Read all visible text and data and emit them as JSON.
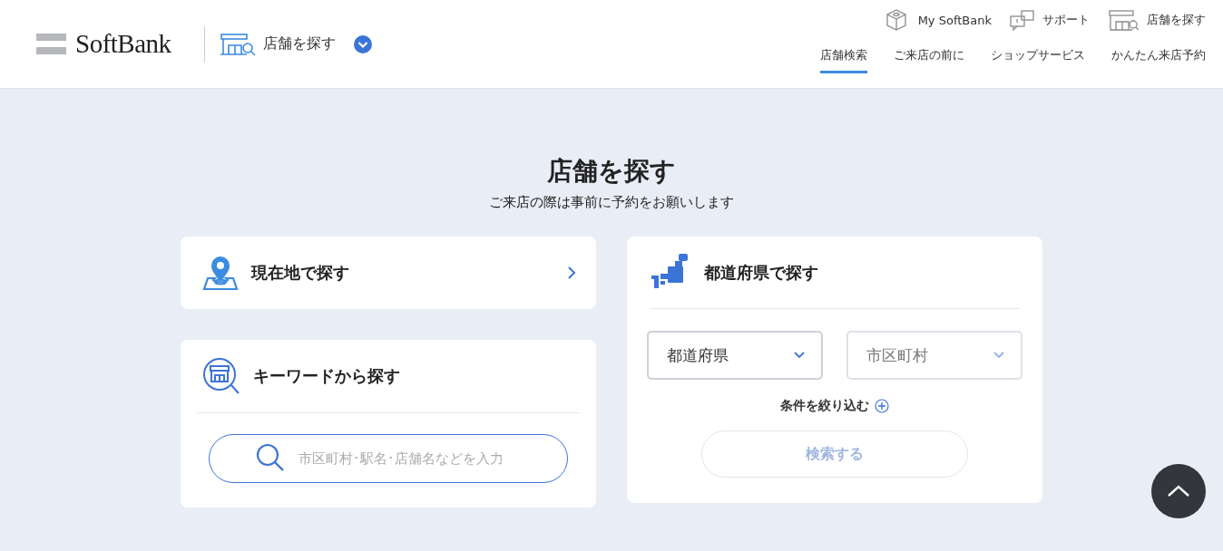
{
  "header": {
    "logo": "SoftBank",
    "section": {
      "label": "店舗を探す"
    },
    "top_links": [
      {
        "kind": "cube",
        "label": "My SoftBank"
      },
      {
        "kind": "chat",
        "label": "サポート"
      },
      {
        "kind": "shop",
        "label": "店舗を探す"
      }
    ],
    "nav": [
      {
        "label": "店舗検索",
        "selected": true
      },
      {
        "label": "ご来店の前に",
        "selected": false
      },
      {
        "label": "ショップサービス",
        "selected": false
      },
      {
        "label": "かんたん来店予約",
        "selected": false
      }
    ]
  },
  "page": {
    "title": "店舗を探す",
    "subtitle": "ご来店の際は事前に予約をお願いします"
  },
  "location_card": {
    "label": "現在地で探す"
  },
  "keyword_card": {
    "title": "キーワードから探す",
    "search": {
      "placeholder": "市区町村･駅名･店舗名などを入力"
    }
  },
  "prefecture_card": {
    "title": "都道府県で探す",
    "selects": [
      {
        "value": "都道府県",
        "disabled": false
      },
      {
        "value": "市区町村",
        "disabled": true
      }
    ],
    "refine": "条件を絞り込む",
    "search_button": {
      "label": "検索する",
      "disabled": true
    }
  }
}
